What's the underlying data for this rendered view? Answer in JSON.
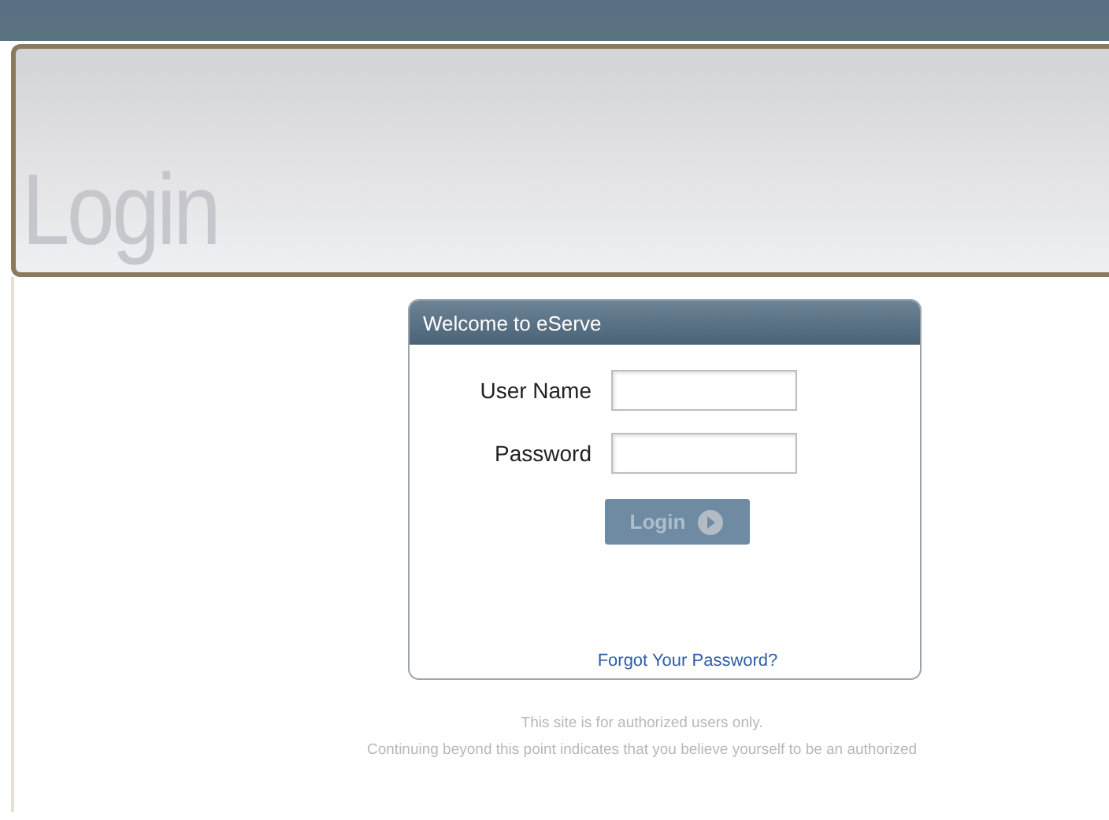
{
  "page_title": "Login",
  "login_panel": {
    "title": "Welcome to eServe",
    "fields": [
      {
        "label": "User Name"
      },
      {
        "label": "Password"
      }
    ],
    "button": {
      "label": "Login",
      "disabled": true
    },
    "link": "Forgot Your Password?"
  },
  "notice": [
    "This site is for authorized users only.",
    "Continuing beyond this point indicates that you believe yourself to be an authorized"
  ]
}
